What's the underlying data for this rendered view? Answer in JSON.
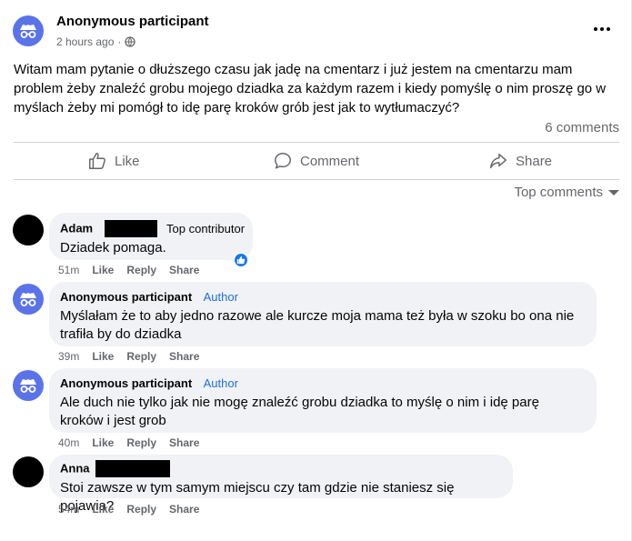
{
  "post": {
    "author": "Anonymous participant",
    "time": "2 hours ago",
    "separator": "·",
    "text": "Witam mam pytanie o dłuższego czasu jak jadę na cmentarz i już jestem na cmentarzu mam problem żeby znaleźć grobu mojego dziadka za każdym razem i kiedy pomyślę o nim proszę go w myślach żeby mi pomógł to idę parę kroków grób jest  jak to wytłumaczyć?",
    "comment_count": "6 comments"
  },
  "actions": {
    "like": "Like",
    "comment": "Comment",
    "share": "Share"
  },
  "sort": {
    "label": "Top comments"
  },
  "comments": [
    {
      "name": "Adam",
      "badge": "Top contributor",
      "text": "Dziadek pomaga.",
      "time": "51m",
      "like": "Like",
      "reply": "Reply",
      "share": "Share"
    },
    {
      "name": "Anonymous participant",
      "badge": "Author",
      "text": "Myślałam że to aby jedno razowe ale kurcze moja mama też była w szoku bo ona nie trafiła by do dziadka",
      "time": "39m",
      "like": "Like",
      "reply": "Reply",
      "share": "Share"
    },
    {
      "name": "Anonymous participant",
      "badge": "Author",
      "text": "Ale duch nie tylko jak nie mogę znaleźć grobu dziadka to myślę o nim i idę parę kroków i jest grob",
      "time": "40m",
      "like": "Like",
      "reply": "Reply",
      "share": "Share"
    },
    {
      "name": "Anna",
      "text": "Stoi zawsze w tym samym miejscu czy tam gdzie nie staniesz się pojawia?",
      "time": "54m",
      "like": "Like",
      "reply": "Reply",
      "share": "Share"
    }
  ],
  "colors": {
    "accent_blue": "#1877f2",
    "author_blue": "#216fdb",
    "anon_avatar": "#5b73e8",
    "bubble": "#f0f2f5",
    "secondary_text": "#65676b"
  },
  "icons": {
    "anon": "incognito-icon",
    "privacy": "globe-icon",
    "more": "more-icon",
    "like": "thumbs-up-icon",
    "comment": "comment-bubble-icon",
    "share": "share-arrow-icon",
    "reaction": "like-reaction-icon"
  }
}
